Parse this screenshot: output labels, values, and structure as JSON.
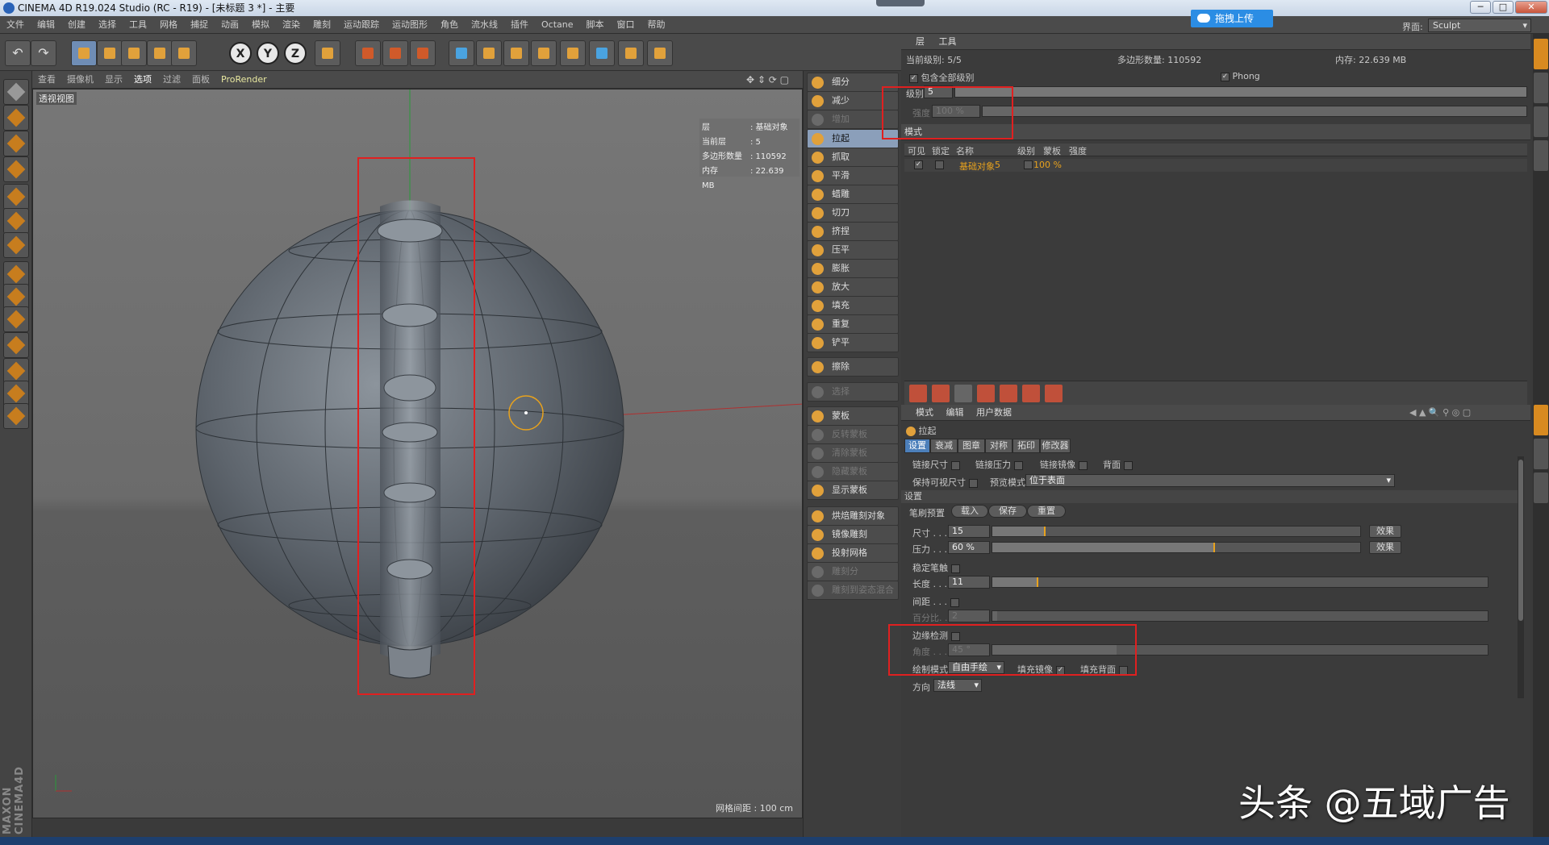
{
  "window": {
    "title": "CINEMA 4D R19.024 Studio (RC - R19) - [未标题 3 *] - 主要",
    "min": "─",
    "max": "□",
    "close": "✕"
  },
  "menu": [
    "文件",
    "编辑",
    "创建",
    "选择",
    "工具",
    "网格",
    "捕捉",
    "动画",
    "模拟",
    "渲染",
    "雕刻",
    "运动跟踪",
    "运动图形",
    "角色",
    "流水线",
    "插件",
    "Octane",
    "脚本",
    "窗口",
    "帮助"
  ],
  "upload": {
    "label": "拖拽上传"
  },
  "layout": {
    "label": "界面:",
    "value": "Sculpt"
  },
  "toolbar": {
    "undo": "↶",
    "redo": "↷",
    "x": "X",
    "y": "Y",
    "z": "Z"
  },
  "viewport": {
    "menu": [
      "查看",
      "摄像机",
      "显示",
      "选项",
      "过滤",
      "面板"
    ],
    "active_menu": "选项",
    "prorender": "ProRender",
    "label": "透视视图",
    "hud": [
      [
        "层",
        ": 基础对象"
      ],
      [
        "当前层",
        ": 5"
      ],
      [
        "多边形数量",
        ": 110592"
      ],
      [
        "内存",
        ": 22.639 MB"
      ]
    ],
    "grid_spacing": "网格间距 : 100 cm"
  },
  "sculpt": {
    "items": [
      {
        "label": "细分",
        "state": "normal"
      },
      {
        "label": "减少",
        "state": "normal"
      },
      {
        "label": "增加",
        "state": "disabled"
      },
      {
        "label": "拉起",
        "state": "selected"
      },
      {
        "label": "抓取",
        "state": "normal"
      },
      {
        "label": "平滑",
        "state": "normal"
      },
      {
        "label": "蜡雕",
        "state": "normal"
      },
      {
        "label": "切刀",
        "state": "normal"
      },
      {
        "label": "挤捏",
        "state": "normal"
      },
      {
        "label": "压平",
        "state": "normal"
      },
      {
        "label": "膨胀",
        "state": "normal"
      },
      {
        "label": "放大",
        "state": "normal"
      },
      {
        "label": "填充",
        "state": "normal"
      },
      {
        "label": "重复",
        "state": "normal"
      },
      {
        "label": "铲平",
        "state": "normal"
      },
      {
        "label": "擦除",
        "state": "normal"
      },
      {
        "label": "选择",
        "state": "disabled"
      },
      {
        "label": "蒙板",
        "state": "normal"
      },
      {
        "label": "反转蒙板",
        "state": "disabled"
      },
      {
        "label": "清除蒙板",
        "state": "disabled"
      },
      {
        "label": "隐藏蒙板",
        "state": "disabled"
      },
      {
        "label": "显示蒙板",
        "state": "normal"
      },
      {
        "label": "烘焙雕刻对象",
        "state": "normal"
      },
      {
        "label": "镜像雕刻",
        "state": "normal"
      },
      {
        "label": "投射网格",
        "state": "normal"
      },
      {
        "label": "雕刻分",
        "state": "disabled"
      },
      {
        "label": "雕刻到姿态混合",
        "state": "disabled"
      }
    ]
  },
  "layers": {
    "tabs": [
      "层",
      "工具"
    ],
    "current_level": "当前级别: 5/5",
    "poly_count": "多边形数量: 110592",
    "memory": "内存: 22.639 MB",
    "include_sub": "包含全部级别",
    "phong": "Phong",
    "level_label": "级别",
    "level_value": "5",
    "strength_label": "强度",
    "strength_value": "100 %",
    "mode_header": "模式",
    "columns": [
      "可见",
      "锁定",
      "名称",
      "级别",
      "蒙板",
      "强度"
    ],
    "row": {
      "name": "基础对象",
      "level": "5",
      "strength": "100 %"
    }
  },
  "attributes": {
    "menu": [
      "模式",
      "编辑",
      "用户数据"
    ],
    "tool_name": "拉起",
    "tabs": [
      "设置",
      "衰减",
      "图章",
      "对称",
      "拓印",
      "修改器"
    ],
    "link_size": "链接尺寸",
    "link_pressure": "链接压力",
    "link_mirror": "链接镜像",
    "backface": "背面",
    "keep_size": "保持可视尺寸",
    "preview_mode_label": "预览模式",
    "preview_mode": "位于表面",
    "section": "设置",
    "preset_label": "笔刷预置",
    "load": "载入",
    "save": "保存",
    "reset": "重置",
    "size_label": "尺寸 . . .",
    "size_value": "15",
    "pressure_label": "压力 . . .",
    "pressure_value": "60 %",
    "effect": "效果",
    "stabilize": "稳定笔触",
    "length_label": "长度 . . .",
    "length_value": "11",
    "spacing": "间距 . . .",
    "percent_label": "百分比. . .",
    "percent_value": "2",
    "edge": "边缘检测",
    "angle_label": "角度 . . .",
    "angle_value": "45 °",
    "draw_mode_label": "绘制模式",
    "draw_mode": "自由手绘",
    "fill_mirror": "填充镜像",
    "fill_back": "填充背面",
    "direction_label": "方向",
    "direction": "法线"
  },
  "watermark": "头条 @五域广告",
  "colors": {
    "accent": "#e8a21d",
    "selected": "#4c7fba",
    "annotation": "#e02020"
  }
}
